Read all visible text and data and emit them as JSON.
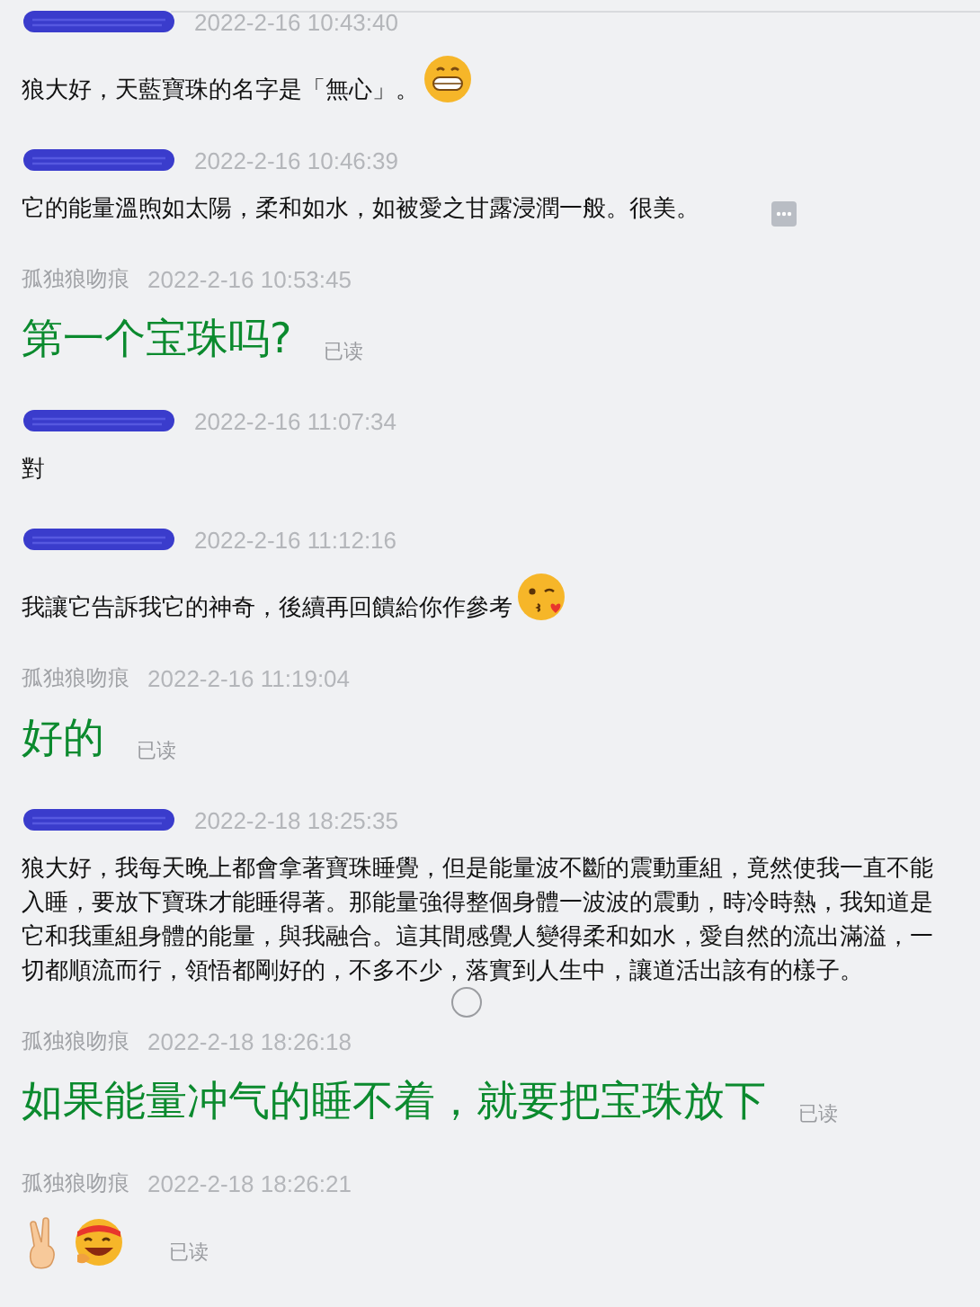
{
  "messages": [
    {
      "redacted": true,
      "time": "2022-2-16 10:43:40",
      "text": "狼大好，天藍寶珠的名字是「無心」。",
      "kind": "text",
      "icons": [
        {
          "kind": "grin"
        }
      ]
    },
    {
      "redacted": true,
      "time": "2022-2-16 10:46:39",
      "text": "它的能量溫煦如太陽，柔和如水，如被愛之甘露浸潤一般。很美。",
      "kind": "text",
      "more": true
    },
    {
      "redacted": false,
      "sender": "孤独狼吻痕",
      "time": "2022-2-16 10:53:45",
      "text": "第一个宝珠吗?",
      "kind": "large",
      "receipt": "已读"
    },
    {
      "redacted": true,
      "time": "2022-2-16 11:07:34",
      "text": "對",
      "kind": "text"
    },
    {
      "redacted": true,
      "time": "2022-2-16 11:12:16",
      "text": "我讓它告訴我它的神奇，後續再回饋給你作參考",
      "kind": "text",
      "icons": [
        {
          "kind": "kiss"
        }
      ]
    },
    {
      "redacted": false,
      "sender": "孤独狼吻痕",
      "time": "2022-2-16 11:19:04",
      "text": "好的",
      "kind": "large",
      "receipt": "已读"
    },
    {
      "redacted": true,
      "time": "2022-2-18 18:25:35",
      "text": "狼大好，我每天晚上都會拿著寶珠睡覺，但是能量波不斷的震動重組，竟然使我一直不能入睡，要放下寶珠才能睡得著。那能量強得整個身體一波波的震動，時冷時熱，我知道是它和我重組身體的能量，與我融合。這其間感覺人變得柔和如水，愛自然的流出滿溢，一切都順流而行，領悟都剛好的，不多不少，落實到人生中，讓道活出該有的樣子。",
      "kind": "text"
    },
    {
      "redacted": false,
      "sender": "孤独狼吻痕",
      "time": "2022-2-18 18:26:18",
      "text": "如果能量冲气的睡不着，就要把宝珠放下",
      "kind": "large",
      "receipt": "已读"
    },
    {
      "redacted": false,
      "sender": "孤独狼吻痕",
      "time": "2022-2-18 18:26:21",
      "kind": "icons",
      "icons": [
        {
          "kind": "victory"
        },
        {
          "kind": "laugh"
        }
      ],
      "receipt": "已读"
    }
  ],
  "loading": true
}
